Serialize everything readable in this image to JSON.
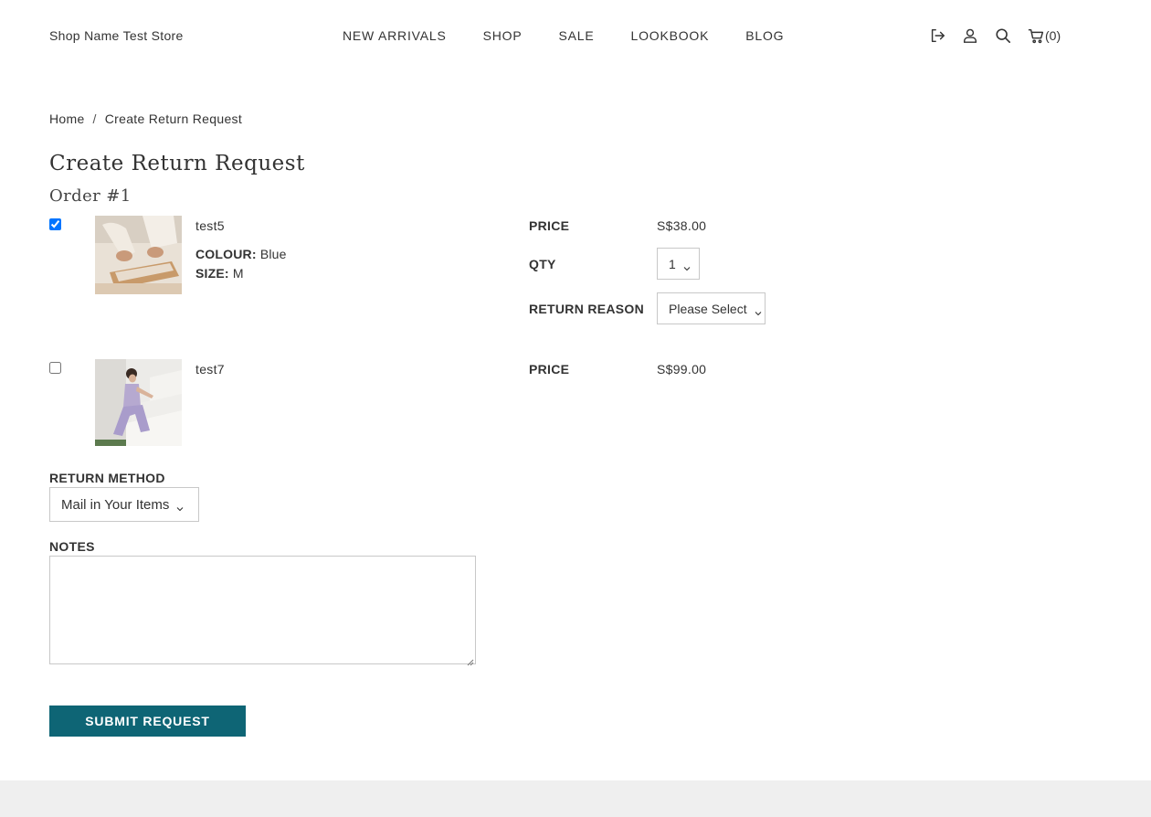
{
  "header": {
    "store_name": "Shop Name Test Store",
    "nav": [
      {
        "label": "NEW ARRIVALS"
      },
      {
        "label": "SHOP"
      },
      {
        "label": "SALE"
      },
      {
        "label": "LOOKBOOK"
      },
      {
        "label": "BLOG"
      }
    ],
    "icons": [
      "logout-icon",
      "user-icon",
      "search-icon",
      "cart-icon"
    ],
    "cart_count": "(0)"
  },
  "breadcrumb": {
    "home": "Home",
    "separator": "/",
    "current": "Create Return Request"
  },
  "page_title": "Create Return Request",
  "order_title": "Order #1",
  "items": [
    {
      "checked": true,
      "name": "test5",
      "colour_label": "COLOUR:",
      "colour_value": "Blue",
      "size_label": "SIZE:",
      "size_value": "M",
      "price_label": "PRICE",
      "price": "S$38.00",
      "qty_label": "QTY",
      "qty_value": "1",
      "reason_label": "RETURN REASON",
      "reason_value": "Please Select"
    },
    {
      "checked": false,
      "name": "test7",
      "price_label": "PRICE",
      "price": "S$99.00"
    }
  ],
  "return_method": {
    "label": "RETURN METHOD",
    "value": "Mail in Your Items"
  },
  "notes": {
    "label": "NOTES",
    "value": ""
  },
  "submit_label": "SUBMIT REQUEST",
  "colors": {
    "accent": "#0e6575",
    "footer_bg": "#efefef",
    "text": "#333333"
  }
}
